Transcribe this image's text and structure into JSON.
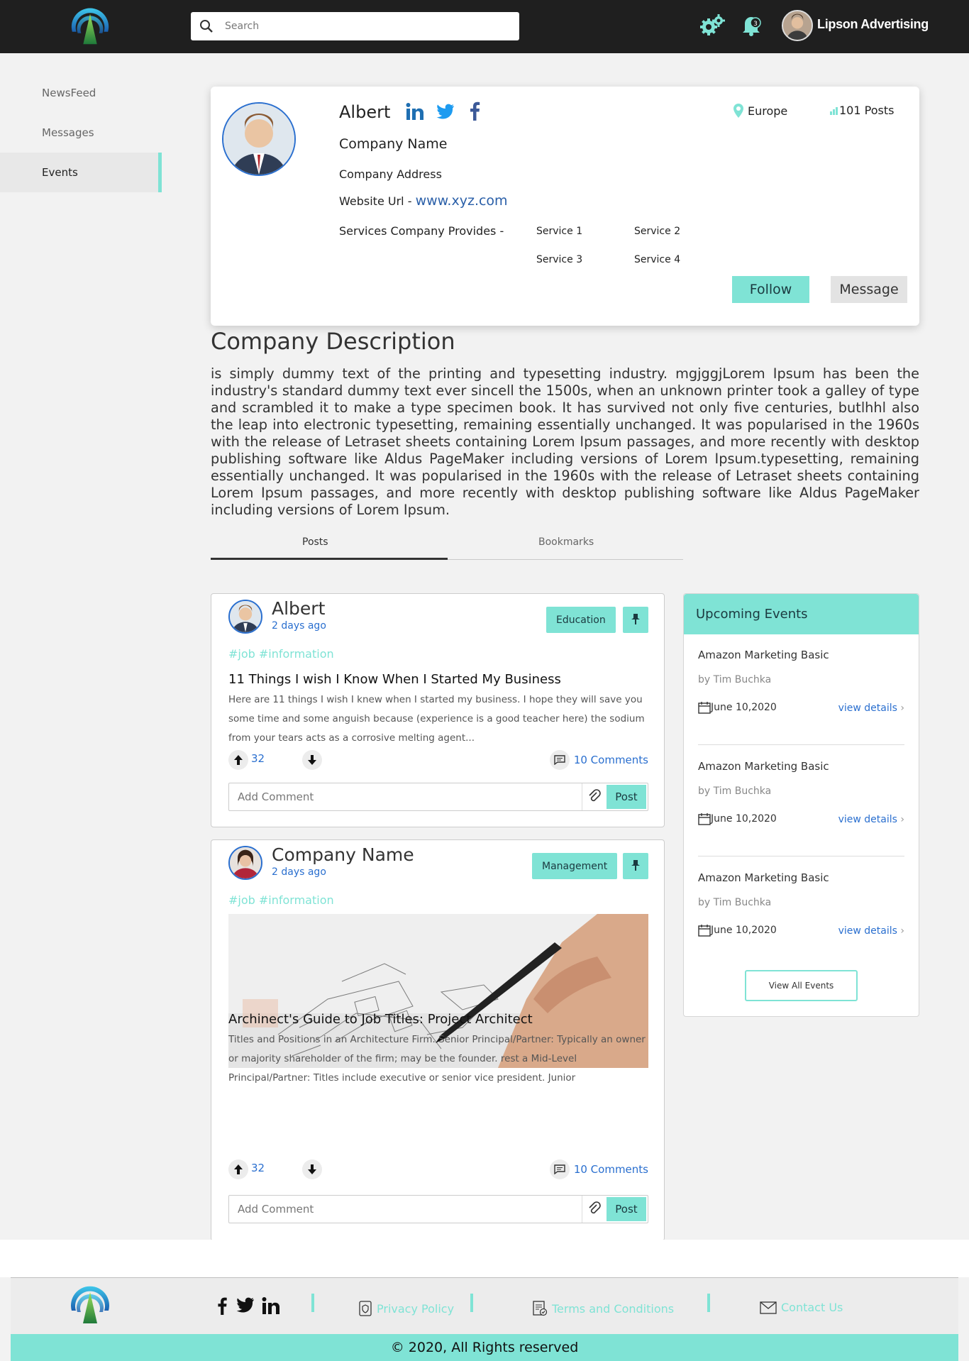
{
  "header": {
    "search_placeholder": "Search",
    "notification_count": "3",
    "user_name": "Lipson Advertising"
  },
  "sidebar": {
    "items": [
      {
        "label": "NewsFeed",
        "active": false
      },
      {
        "label": "Messages",
        "active": false
      },
      {
        "label": "Events",
        "active": true
      }
    ]
  },
  "profile": {
    "name": "Albert",
    "company_name": "Company Name",
    "company_address": "Company Address",
    "website_label": "Website Url -",
    "website_url": "www.xyz.com",
    "services_label": "Services Company Provides -",
    "services": [
      "Service 1",
      "Service 2",
      "Service 3",
      "Service 4"
    ],
    "location": "Europe",
    "posts_count": "101 Posts",
    "follow_label": "Follow",
    "message_label": "Message"
  },
  "description": {
    "title": "Company Description",
    "text": "is simply dummy text of the printing and typesetting industry. mgjggjLorem Ipsum has been the industry's standard dummy text ever sincell the 1500s, when an unknown printer took a galley of type and scrambled it to make a type specimen book. It has survived not only five centuries, butlhhl also the leap into electronic typesetting, remaining essentially unchanged. It was popularised in the 1960s with the release of Letraset sheets containing Lorem Ipsum passages, and more recently with desktop publishing software like Aldus PageMaker including versions of Lorem Ipsum.typesetting, remaining essentially unchanged. It was popularised in the 1960s with the release of Letraset sheets containing Lorem Ipsum passages, and more recently with desktop publishing software like Aldus PageMaker including versions of Lorem Ipsum."
  },
  "tabs": {
    "posts": "Posts",
    "bookmarks": "Bookmarks"
  },
  "posts": [
    {
      "author": "Albert",
      "time": "2 days ago",
      "tag": "Education",
      "hashtags": "#job #information",
      "title": "11 Things I wish I Know When I Started My Business",
      "body": "Here are 11 things I wish I knew when I started my business. I hope they will save you some time and some anguish because (experience is a good teacher here) the sodium from your tears acts as a corrosive melting agent...",
      "upvotes": "32",
      "comments": "10 Comments",
      "comment_placeholder": "Add Comment",
      "post_label": "Post"
    },
    {
      "author": "Company Name",
      "time": "2 days ago",
      "tag": "Management",
      "hashtags": "#job #information",
      "title": "Archinect's Guide to Job Titles: Project Architect",
      "body": "Titles and Positions in an Architecture Firm. Senior Principal/Partner: Typically an owner or majority shareholder of the firm; may be the founder. rest a Mid-Level Principal/Partner: Titles include executive or senior vice president. Junior",
      "upvotes": "32",
      "comments": "10 Comments",
      "comment_placeholder": "Add Comment",
      "post_label": "Post"
    }
  ],
  "events": {
    "title": "Upcoming Events",
    "items": [
      {
        "title": "Amazon Marketing Basic",
        "by": "by Tim Buchka",
        "date": "June 10,2020",
        "view": "view details"
      },
      {
        "title": "Amazon Marketing Basic",
        "by": "by Tim Buchka",
        "date": "June 10,2020",
        "view": "view details"
      },
      {
        "title": "Amazon Marketing Basic",
        "by": "by Tim Buchka",
        "date": "June 10,2020",
        "view": "view details"
      }
    ],
    "view_all": "View All Events"
  },
  "footer": {
    "privacy": "Privacy Policy",
    "terms": "Terms and Conditions",
    "contact": "Contact Us",
    "copyright": "© 2020, All Rights reserved"
  },
  "colors": {
    "accent": "#7fe3d5",
    "link": "#2a6fcf",
    "header_bg": "#1f1f1f"
  }
}
